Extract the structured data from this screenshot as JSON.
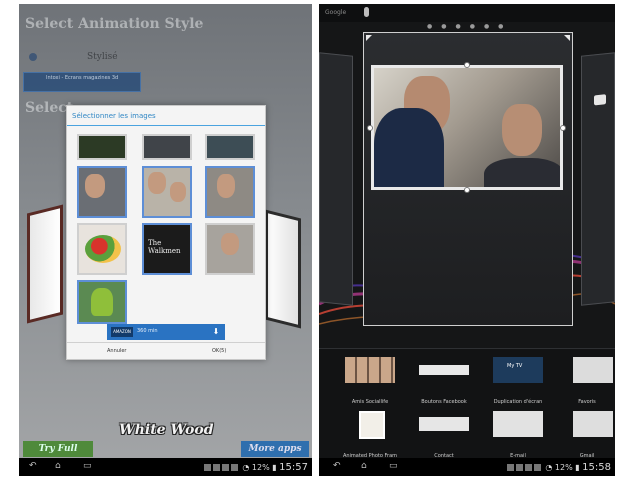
{
  "left_screen": {
    "title": "Select Animation Style",
    "title2": "Select",
    "style_option": "Stylisé",
    "widget_text": "Intoxi - Ecrans magazines 3d",
    "white_wood": "White Wood",
    "try_button": "Try Full Version",
    "more_button": "More apps",
    "dialog": {
      "title": "Sélectionner les images",
      "download_bar_label": "360 min",
      "download_logo": "AMAZON",
      "cancel": "Annuler",
      "ok": "OK(5)",
      "thumb_text_walkmen": "The Walkmen"
    },
    "status": {
      "percent": "12%",
      "time": "15:57"
    }
  },
  "right_screen": {
    "google": "Google",
    "status": {
      "percent": "12%",
      "time": "15:58"
    },
    "tray": {
      "row1": [
        "Amis Sociallife",
        "Boutons Facebook",
        "Duplication d'écran",
        "Favoris"
      ],
      "row2": [
        "Animated Photo Fram",
        "Contact",
        "E-mail",
        "Gmail"
      ],
      "mytv_label": "My TV"
    }
  },
  "colors": {
    "accent_blue": "#2f86c4",
    "selection_blue": "#5d8ed6",
    "try_green": "#4f8a3b",
    "more_blue": "#2f6fae"
  }
}
